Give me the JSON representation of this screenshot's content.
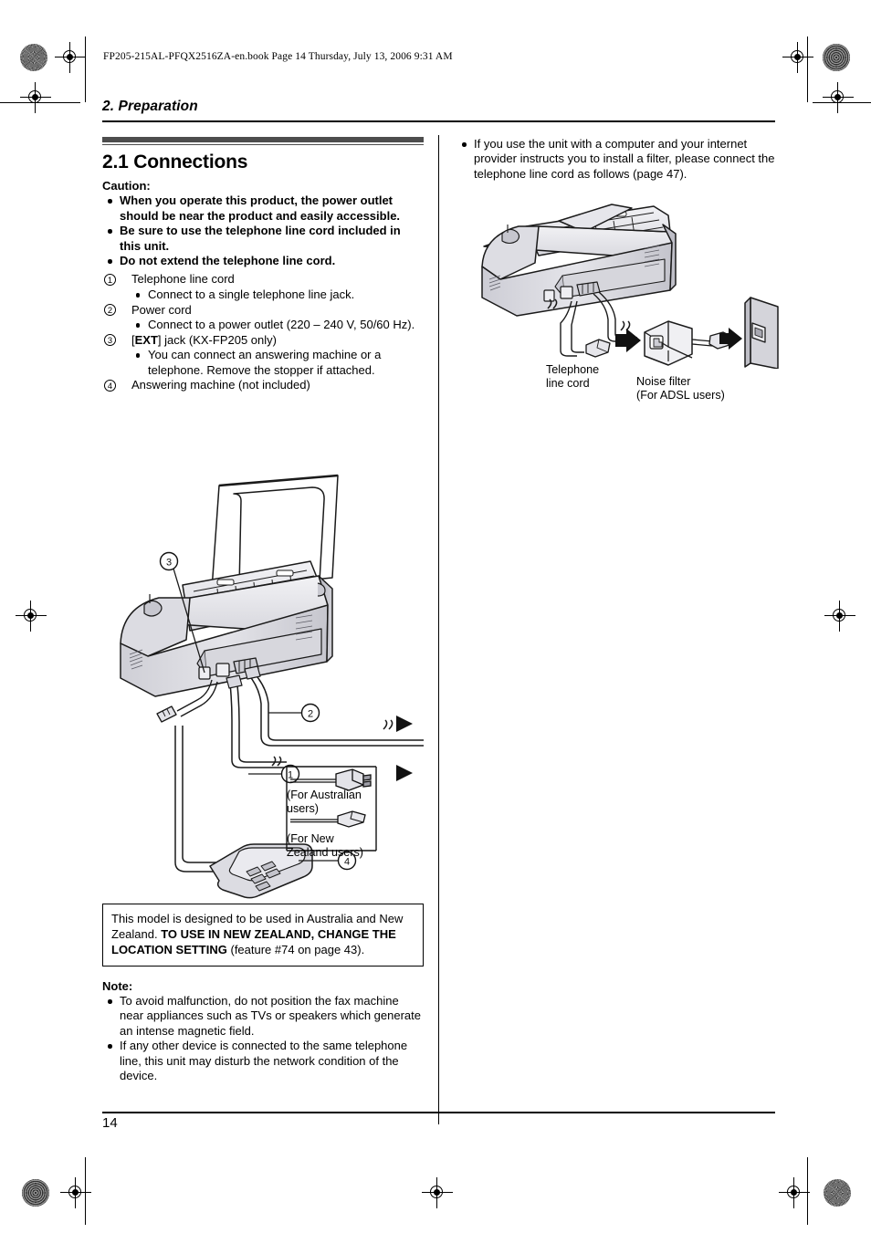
{
  "header": {
    "file_info": "FP205-215AL-PFQX2516ZA-en.book  Page 14  Thursday, July 13, 2006  9:31 AM",
    "chapter_title": "2. Preparation"
  },
  "left_column": {
    "section_title": "2.1 Connections",
    "caution_label": "Caution:",
    "caution_items": [
      "When you operate this product, the power outlet should be near the product and easily accessible.",
      "Be sure to use the telephone line cord included in this unit.",
      "Do not extend the telephone line cord."
    ],
    "numbered_items": [
      {
        "num": "1",
        "title": "Telephone line cord",
        "subs": [
          "Connect to a single telephone line jack."
        ]
      },
      {
        "num": "2",
        "title": "Power cord",
        "subs": [
          "Connect to a power outlet (220 – 240 V, 50/60 Hz)."
        ]
      },
      {
        "num": "3",
        "title_pre": "[",
        "title_bold": "EXT",
        "title_post": "] jack (KX-FP205 only)",
        "subs": [
          "You can connect an answering machine or a telephone. Remove the stopper if attached."
        ]
      },
      {
        "num": "4",
        "title": "Answering machine (not included)",
        "subs": []
      }
    ],
    "diagram": {
      "callout_3": "3",
      "callout_2": "2",
      "callout_1": "1",
      "callout_4": "4",
      "plug_box_line1": "(For Australian",
      "plug_box_line2": "users)",
      "plug_box_line3": "(For New",
      "plug_box_line4": "Zealand users)"
    },
    "model_note": {
      "text_a": "This model is designed to be used in Australia and New Zealand. ",
      "text_bold": "TO USE IN NEW ZEALAND, CHANGE THE LOCATION SETTING",
      "text_b": " (feature #74 on page 43)."
    },
    "note_label": "Note:",
    "note_items": [
      "To avoid malfunction, do not position the fax machine near appliances such as TVs or speakers which generate an intense magnetic field.",
      "If any other device is connected to the same telephone line, this unit may disturb the network condition of the device."
    ]
  },
  "right_column": {
    "intro_items": [
      "If you use the unit with a computer and your internet provider instructs you to install a filter, please connect the telephone line cord as follows (page 47)."
    ],
    "diagram": {
      "label_tel_line1": "Telephone",
      "label_tel_line2": "line cord",
      "label_filter_line1": "Noise filter",
      "label_filter_line2": "(For ADSL users)"
    }
  },
  "footer": {
    "page_number": "14"
  },
  "colors": {
    "section_bar": "#4d4d4d",
    "drawing_light": "#e9e9ed",
    "drawing_mid": "#d2d2d8",
    "drawing_dark": "#b3b3bb",
    "drawing_darker": "#9a9aa3",
    "outline": "#1a1a1a"
  }
}
